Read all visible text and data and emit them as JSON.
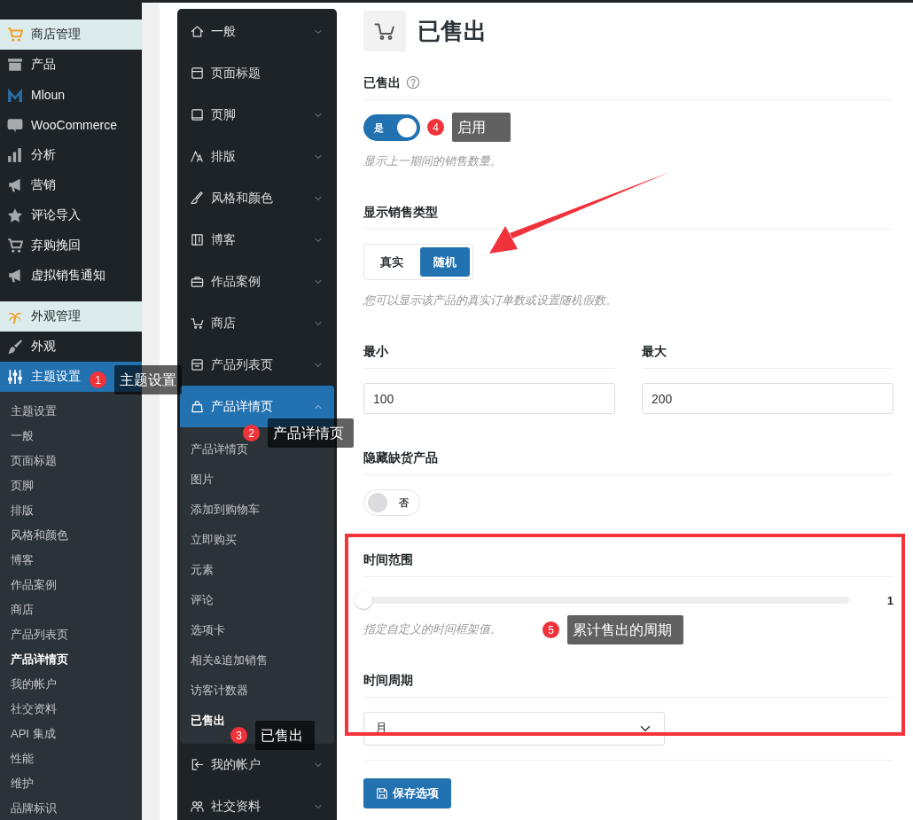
{
  "admin_menu": {
    "items": [
      {
        "label": "商店管理",
        "kind": "group",
        "selected": false
      },
      {
        "label": "产品",
        "kind": "item",
        "selected": false
      },
      {
        "label": "Mloun",
        "kind": "item",
        "selected": false
      },
      {
        "label": "WooCommerce",
        "kind": "item",
        "selected": false
      },
      {
        "label": "分析",
        "kind": "item",
        "selected": false
      },
      {
        "label": "营销",
        "kind": "item",
        "selected": false
      },
      {
        "label": "评论导入",
        "kind": "item",
        "selected": false
      },
      {
        "label": "弃购挽回",
        "kind": "item",
        "selected": false
      },
      {
        "label": "虚拟销售通知",
        "kind": "item",
        "selected": false
      },
      {
        "label": "外观管理",
        "kind": "group",
        "selected": false
      },
      {
        "label": "外观",
        "kind": "item",
        "selected": false
      },
      {
        "label": "主题设置",
        "kind": "item",
        "selected": true
      }
    ],
    "submenu": [
      {
        "label": "主题设置",
        "selected": false
      },
      {
        "label": "一般",
        "selected": false
      },
      {
        "label": "页面标题",
        "selected": false
      },
      {
        "label": "页脚",
        "selected": false
      },
      {
        "label": "排版",
        "selected": false
      },
      {
        "label": "风格和颜色",
        "selected": false
      },
      {
        "label": "博客",
        "selected": false
      },
      {
        "label": "作品案例",
        "selected": false
      },
      {
        "label": "商店",
        "selected": false
      },
      {
        "label": "产品列表页",
        "selected": false
      },
      {
        "label": "产品详情页",
        "selected": true
      },
      {
        "label": "我的帐户",
        "selected": false
      },
      {
        "label": "社交资料",
        "selected": false
      },
      {
        "label": "API 集成",
        "selected": false
      },
      {
        "label": "性能",
        "selected": false
      },
      {
        "label": "维护",
        "selected": false
      },
      {
        "label": "品牌标识",
        "selected": false
      }
    ]
  },
  "theme_nav": [
    {
      "label": "一般",
      "kind": "group",
      "expanded": false,
      "selected": false
    },
    {
      "label": "页面标题",
      "kind": "link",
      "selected": false
    },
    {
      "label": "页脚",
      "kind": "group",
      "expanded": false,
      "selected": false
    },
    {
      "label": "排版",
      "kind": "group",
      "expanded": false,
      "selected": false
    },
    {
      "label": "风格和颜色",
      "kind": "group",
      "expanded": false,
      "selected": false
    },
    {
      "label": "博客",
      "kind": "group",
      "expanded": false,
      "selected": false
    },
    {
      "label": "作品案例",
      "kind": "group",
      "expanded": false,
      "selected": false
    },
    {
      "label": "商店",
      "kind": "group",
      "expanded": false,
      "selected": false
    },
    {
      "label": "产品列表页",
      "kind": "group",
      "expanded": false,
      "selected": false
    },
    {
      "label": "产品详情页",
      "kind": "group",
      "expanded": true,
      "selected": true,
      "children": [
        {
          "label": "产品详情页",
          "selected": false
        },
        {
          "label": "图片",
          "selected": false
        },
        {
          "label": "添加到购物车",
          "selected": false
        },
        {
          "label": "立即购买",
          "selected": false
        },
        {
          "label": "元素",
          "selected": false
        },
        {
          "label": "评论",
          "selected": false
        },
        {
          "label": "选项卡",
          "selected": false
        },
        {
          "label": "相关&追加销售",
          "selected": false
        },
        {
          "label": "访客计数器",
          "selected": false
        },
        {
          "label": "已售出",
          "selected": true
        }
      ]
    },
    {
      "label": "我的帐户",
      "kind": "group",
      "expanded": false,
      "selected": false
    },
    {
      "label": "社交资料",
      "kind": "group",
      "expanded": false,
      "selected": false
    }
  ],
  "page_title": "已售出",
  "settings": [
    {
      "kind": "toggle",
      "label": "已售出",
      "help": true,
      "on": true,
      "state_text": "是",
      "description": "显示上一期间的销售数量。"
    },
    {
      "kind": "segmented",
      "label": "显示销售类型",
      "options": [
        {
          "label": "真实",
          "selected": false
        },
        {
          "label": "随机",
          "selected": true
        }
      ],
      "description": "您可以显示该产品的真实订单数或设置随机假数。"
    },
    {
      "kind": "inputs",
      "fields": [
        {
          "label": "最小",
          "value": "100"
        },
        {
          "label": "最大",
          "value": "200"
        }
      ]
    },
    {
      "kind": "toggle",
      "label": "隐藏缺货产品",
      "on": false,
      "state_text": "否"
    },
    {
      "kind": "slider",
      "label": "时间范围",
      "level": 0,
      "reading": "1",
      "description": "指定自定义的时间框架值。"
    },
    {
      "kind": "select",
      "label": "时间周期",
      "value": "月"
    }
  ],
  "save_button": "保存选项",
  "annotations": [
    {
      "number": "1",
      "text": "主题设置"
    },
    {
      "number": "2",
      "text": "产品详情页"
    },
    {
      "number": "3",
      "text": "已售出"
    },
    {
      "number": "4",
      "text": "启用"
    },
    {
      "number": "5",
      "text": "累计售出的周期"
    }
  ]
}
